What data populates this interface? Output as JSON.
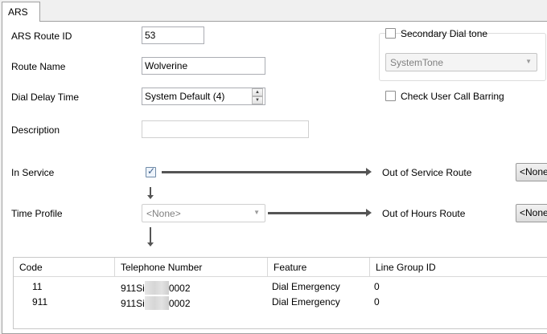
{
  "tab": {
    "label": "ARS"
  },
  "fields": {
    "route_id": {
      "label": "ARS Route ID",
      "value": "53"
    },
    "route_name": {
      "label": "Route Name",
      "value": "Wolverine"
    },
    "dial_delay": {
      "label": "Dial Delay Time",
      "value": "System Default (4)"
    },
    "description": {
      "label": "Description",
      "value": ""
    },
    "in_service": {
      "label": "In Service",
      "checked": true
    },
    "time_profile": {
      "label": "Time Profile",
      "value": "<None>"
    }
  },
  "secondary_dial_tone": {
    "label": "Secondary Dial tone",
    "checked": false,
    "select_value": "SystemTone"
  },
  "check_call_barring": {
    "label": "Check User Call Barring",
    "checked": false
  },
  "out_of_service": {
    "label": "Out of Service Route",
    "button": "<None>"
  },
  "out_of_hours": {
    "label": "Out of Hours Route",
    "button": "<None>"
  },
  "table": {
    "columns": [
      "Code",
      "Telephone Number",
      "Feature",
      "Line Group ID"
    ],
    "rows": [
      {
        "code": "11",
        "tel_prefix": "911Si",
        "tel_suffix": "0002",
        "feature": "Dial Emergency",
        "line_group": "0"
      },
      {
        "code": "911",
        "tel_prefix": "911Si",
        "tel_suffix": "0002",
        "feature": "Dial Emergency",
        "line_group": "0"
      }
    ]
  },
  "icons": {
    "spin_up": "spin-up-icon",
    "spin_down": "spin-down-icon",
    "dropdown": "chevron-down-icon",
    "check": "checkmark-icon"
  }
}
